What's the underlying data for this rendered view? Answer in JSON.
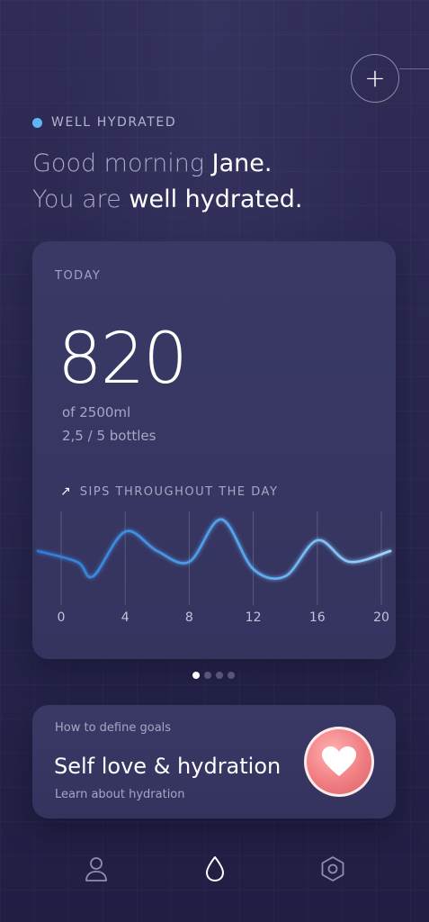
{
  "header": {
    "add_label": "+"
  },
  "status": {
    "label": "WELL HYDRATED",
    "dot_color": "#5eb6f5"
  },
  "greeting": {
    "line1_pre": "Good morning ",
    "name": "Jane.",
    "line2_pre": "You are ",
    "state": "well hydrated."
  },
  "today": {
    "label": "TODAY",
    "amount": "820",
    "goal": "of 2500ml",
    "bottles": "2,5 / 5 bottles",
    "chart_title": "SIPS THROUGHOUT THE DAY"
  },
  "chart_data": {
    "type": "line",
    "title": "SIPS THROUGHOUT THE DAY",
    "x": [
      0,
      1,
      2,
      4,
      6,
      8,
      10,
      12,
      14,
      16,
      18,
      20
    ],
    "xticks": [
      "0",
      "4",
      "8",
      "12",
      "16",
      "20"
    ],
    "series": [
      {
        "values": [
          0.55,
          0.4,
          0.2,
          0.82,
          0.55,
          0.4,
          0.99,
          0.3,
          0.2,
          0.7,
          0.4,
          0.55
        ]
      }
    ],
    "ylim": [
      0,
      1
    ],
    "grid": "vertical",
    "line_colors": [
      "#2e7cd6",
      "#7ac4ff"
    ]
  },
  "carousel": {
    "count": 4,
    "active": 0
  },
  "goal_card": {
    "eyebrow": "How to define goals",
    "title": "Self love & hydration",
    "subtitle": "Learn about hydration",
    "icon": "heart-icon"
  },
  "nav": {
    "items": [
      {
        "icon": "user-icon",
        "active": false
      },
      {
        "icon": "drop-icon",
        "active": true
      },
      {
        "icon": "settings-hexagon-icon",
        "active": false
      }
    ]
  }
}
